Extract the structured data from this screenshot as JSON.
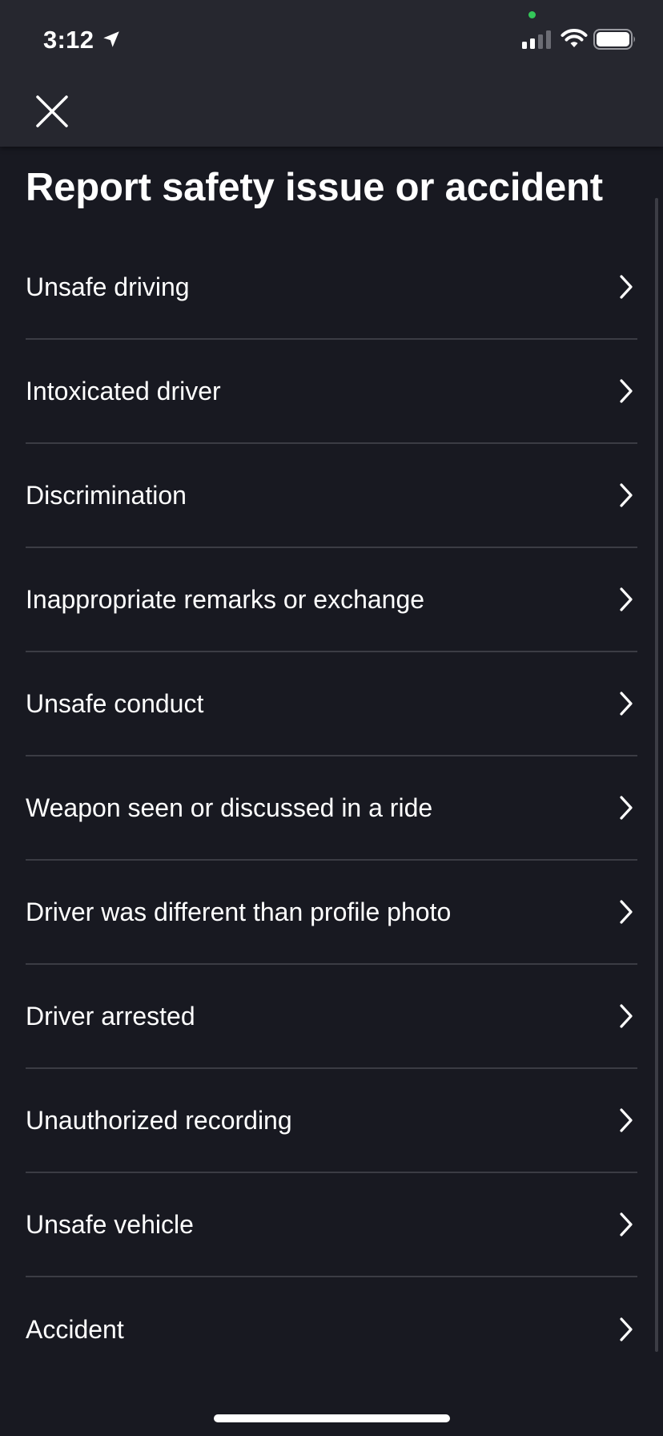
{
  "status_bar": {
    "time": "3:12",
    "privacy_dot_color": "#34c759"
  },
  "header": {
    "close_icon": "close-icon"
  },
  "page": {
    "title": "Report safety issue or accident"
  },
  "options": [
    {
      "label": "Unsafe driving"
    },
    {
      "label": "Intoxicated driver"
    },
    {
      "label": "Discrimination"
    },
    {
      "label": "Inappropriate remarks or exchange"
    },
    {
      "label": "Unsafe conduct"
    },
    {
      "label": "Weapon seen or discussed in a ride"
    },
    {
      "label": "Driver was different than profile photo"
    },
    {
      "label": "Driver arrested"
    },
    {
      "label": "Unauthorized recording"
    },
    {
      "label": "Unsafe vehicle"
    },
    {
      "label": "Accident"
    }
  ],
  "colors": {
    "background": "#181921",
    "header_background": "#26272f",
    "divider": "#3b3c44",
    "text": "#ffffff"
  }
}
